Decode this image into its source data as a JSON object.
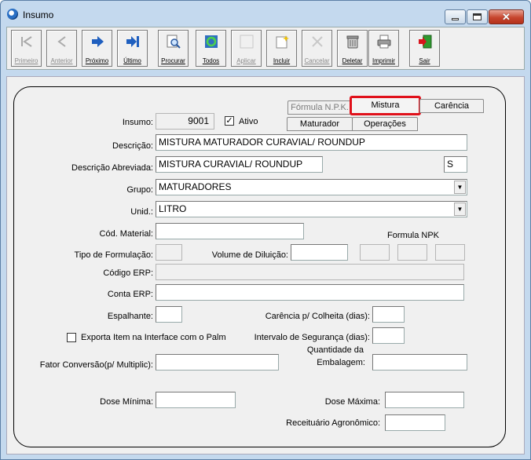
{
  "window": {
    "title": "Insumo"
  },
  "toolbar": [
    {
      "label": "Primeiro",
      "icon": "first-record-icon",
      "enabled": false
    },
    {
      "label": "Anterior",
      "icon": "previous-record-icon",
      "enabled": false
    },
    {
      "label": "Próximo",
      "icon": "next-record-icon",
      "enabled": true
    },
    {
      "label": "Último",
      "icon": "last-record-icon",
      "enabled": true
    },
    {
      "label": "Procurar",
      "icon": "search-icon",
      "enabled": true
    },
    {
      "label": "Todos",
      "icon": "refresh-all-icon",
      "enabled": true
    },
    {
      "label": "Aplicar",
      "icon": "apply-icon",
      "enabled": false
    },
    {
      "label": "Incluir",
      "icon": "new-document-icon",
      "enabled": true
    },
    {
      "label": "Cancelar",
      "icon": "cancel-icon",
      "enabled": false
    },
    {
      "label": "Deletar",
      "icon": "trash-icon",
      "enabled": true
    },
    {
      "label": "Imprimir",
      "icon": "printer-icon",
      "enabled": true
    },
    {
      "label": "Sair",
      "icon": "exit-door-icon",
      "enabled": true
    }
  ],
  "tabs": {
    "formula_npk": "Fórmula N.P.K.",
    "mistura": "Mistura",
    "carencia": "Carência",
    "maturador": "Maturador",
    "operacoes": "Operações",
    "highlight_color": "#e0101a"
  },
  "form": {
    "insumo_label": "Insumo:",
    "insumo_value": "9001",
    "ativo_label": "Ativo",
    "ativo_checked": true,
    "descricao_label": "Descrição:",
    "descricao_value": "MISTURA MATURADOR CURAVIAL/ ROUNDUP",
    "descricao_abreviada_label": "Descrição Abreviada:",
    "descricao_abreviada_value": "MISTURA CURAVIAL/ ROUNDUP",
    "flag_value": "S",
    "grupo_label": "Grupo:",
    "grupo_value": "MATURADORES",
    "unid_label": "Unid.:",
    "unid_value": "LITRO",
    "cod_material_label": "Cód. Material:",
    "cod_material_value": "",
    "formula_npk_label": "Formula NPK",
    "tipo_formulacao_label": "Tipo de Formulação:",
    "volume_diluicao_label": "Volume de Diluição:",
    "codigo_erp_label": "Código ERP:",
    "conta_erp_label": "Conta ERP:",
    "espalhante_label": "Espalhante:",
    "carencia_colheita_label": "Carência p/ Colheita (dias):",
    "exporta_label": "Exporta Item na Interface com o Palm",
    "exporta_checked": false,
    "intervalo_seguranca_label": "Intervalo de Segurança (dias):",
    "quantidade_embalagem_label_1": "Quantidade da",
    "quantidade_embalagem_label_2": "Embalagem:",
    "fator_conversao_label": "Fator Conversão(p/ Multiplic):",
    "dose_minima_label": "Dose Mínima:",
    "dose_maxima_label": "Dose Máxima:",
    "receituario_label": "Receituário Agronômico:"
  }
}
